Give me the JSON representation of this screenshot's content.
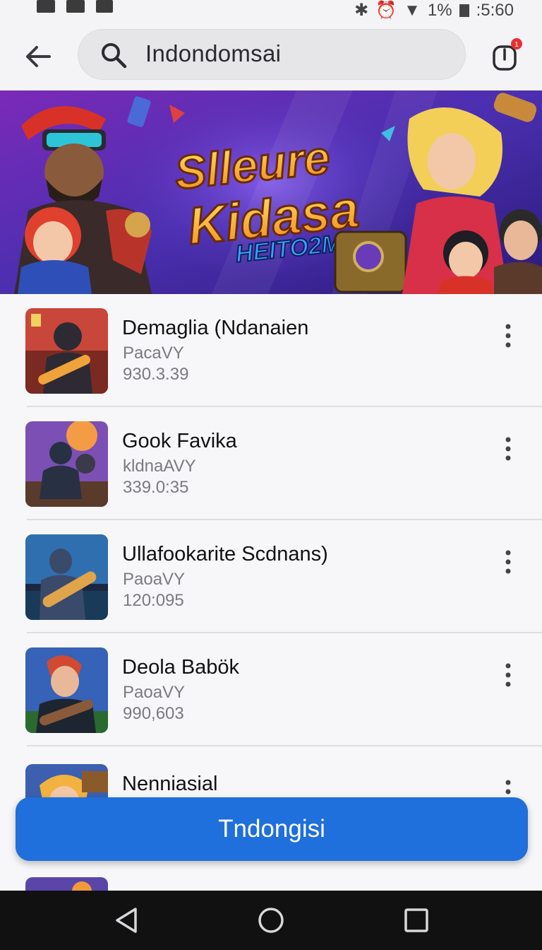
{
  "status_bar": {
    "battery_text": "1%",
    "time": ":5:60"
  },
  "search": {
    "query": "Indondomsai"
  },
  "notification": {
    "badge": "1"
  },
  "banner": {
    "title_line1": "Slleure",
    "title_line2": "Kidasa",
    "title_line3": "HEITO2M"
  },
  "apps": [
    {
      "title": "Demaglia (Ndanaien",
      "subtitle": "PacaVY",
      "version": "930.3.39",
      "thumb_colors": [
        "#c8463a",
        "#f0a33a",
        "#2d2a33"
      ]
    },
    {
      "title": "Gook Favika",
      "subtitle": "kldnaAVY",
      "version": "339.0:35",
      "thumb_colors": [
        "#7c4fb4",
        "#f39c45",
        "#283044"
      ]
    },
    {
      "title": "Ullafookarite Scdnans)",
      "subtitle": "PaoaVY",
      "version": "120:095",
      "thumb_colors": [
        "#2f6fb0",
        "#e0a44a",
        "#1b2740"
      ]
    },
    {
      "title": "Deola Babök",
      "subtitle": "PaoaVY",
      "version": "990,603",
      "thumb_colors": [
        "#3662b8",
        "#d04a32",
        "#1d2530"
      ]
    },
    {
      "title": "Nenniasial",
      "subtitle": "",
      "version": "",
      "thumb_colors": [
        "#3c5fb0",
        "#f2b23f",
        "#2b2b3a"
      ]
    },
    {
      "title": "",
      "subtitle": "",
      "version": "",
      "thumb_colors": [
        "#5a46a8",
        "#f09a3c",
        "#2b2b3a"
      ]
    }
  ],
  "cta": {
    "label": "Tndongisi"
  },
  "colors": {
    "accent": "#1f6fdc",
    "banner_bg": "#5b2fb0",
    "banner_title": "#f7b22a",
    "banner_subtitle": "#2f7fe8"
  }
}
